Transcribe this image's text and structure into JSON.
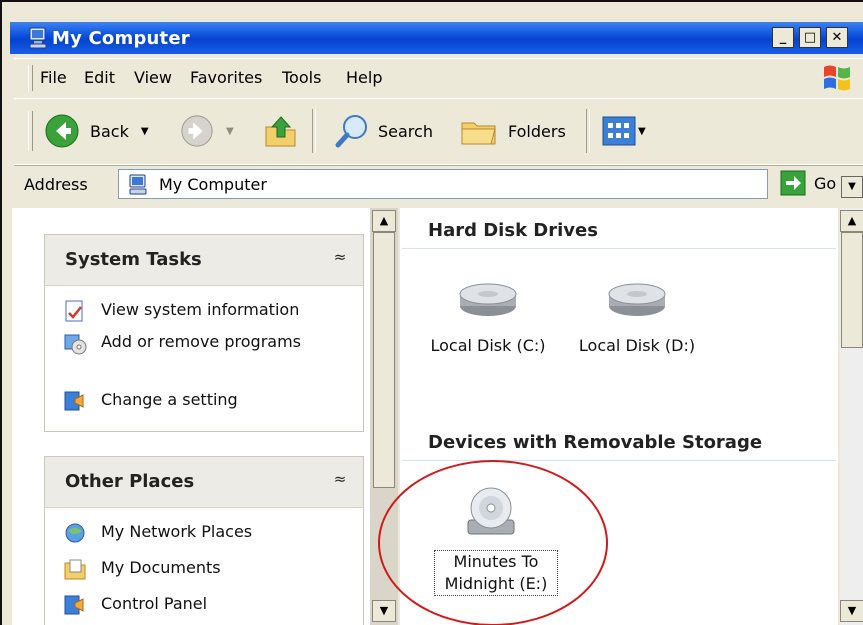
{
  "window": {
    "title": "My Computer"
  },
  "title_buttons": {
    "minimize": "_",
    "maximize": "□",
    "close": "✕"
  },
  "menu": {
    "items": [
      {
        "label": "File"
      },
      {
        "label": "Edit"
      },
      {
        "label": "View"
      },
      {
        "label": "Favorites"
      },
      {
        "label": "Tools"
      },
      {
        "label": "Help"
      }
    ]
  },
  "toolbar": {
    "back_label": "Back",
    "search_label": "Search",
    "folders_label": "Folders"
  },
  "address": {
    "label": "Address",
    "value": "My Computer",
    "go_label": "Go"
  },
  "system_tasks": {
    "title": "System Tasks",
    "items": [
      {
        "label": "View system information",
        "icon": "system-info-icon"
      },
      {
        "label": "Add or remove programs",
        "icon": "add-remove-programs-icon"
      },
      {
        "label": "Change a setting",
        "icon": "control-panel-icon"
      }
    ]
  },
  "other_places": {
    "title": "Other Places",
    "items": [
      {
        "label": "My Network Places",
        "icon": "network-places-icon"
      },
      {
        "label": "My Documents",
        "icon": "my-documents-icon"
      },
      {
        "label": "Control Panel",
        "icon": "control-panel-icon"
      }
    ]
  },
  "hard_disks": {
    "title": "Hard Disk Drives",
    "drives": [
      {
        "label": "Local Disk (C:)"
      },
      {
        "label": "Local Disk (D:)"
      }
    ]
  },
  "removable": {
    "title": "Devices with Removable Storage",
    "drives": [
      {
        "label_line1": "Minutes To",
        "label_line2": "Midnight (E:)"
      }
    ]
  },
  "colors": {
    "title_bar": "#0a4ed9",
    "highlight_ring": "#d21a1a",
    "window_chrome": "#ece9d8"
  }
}
